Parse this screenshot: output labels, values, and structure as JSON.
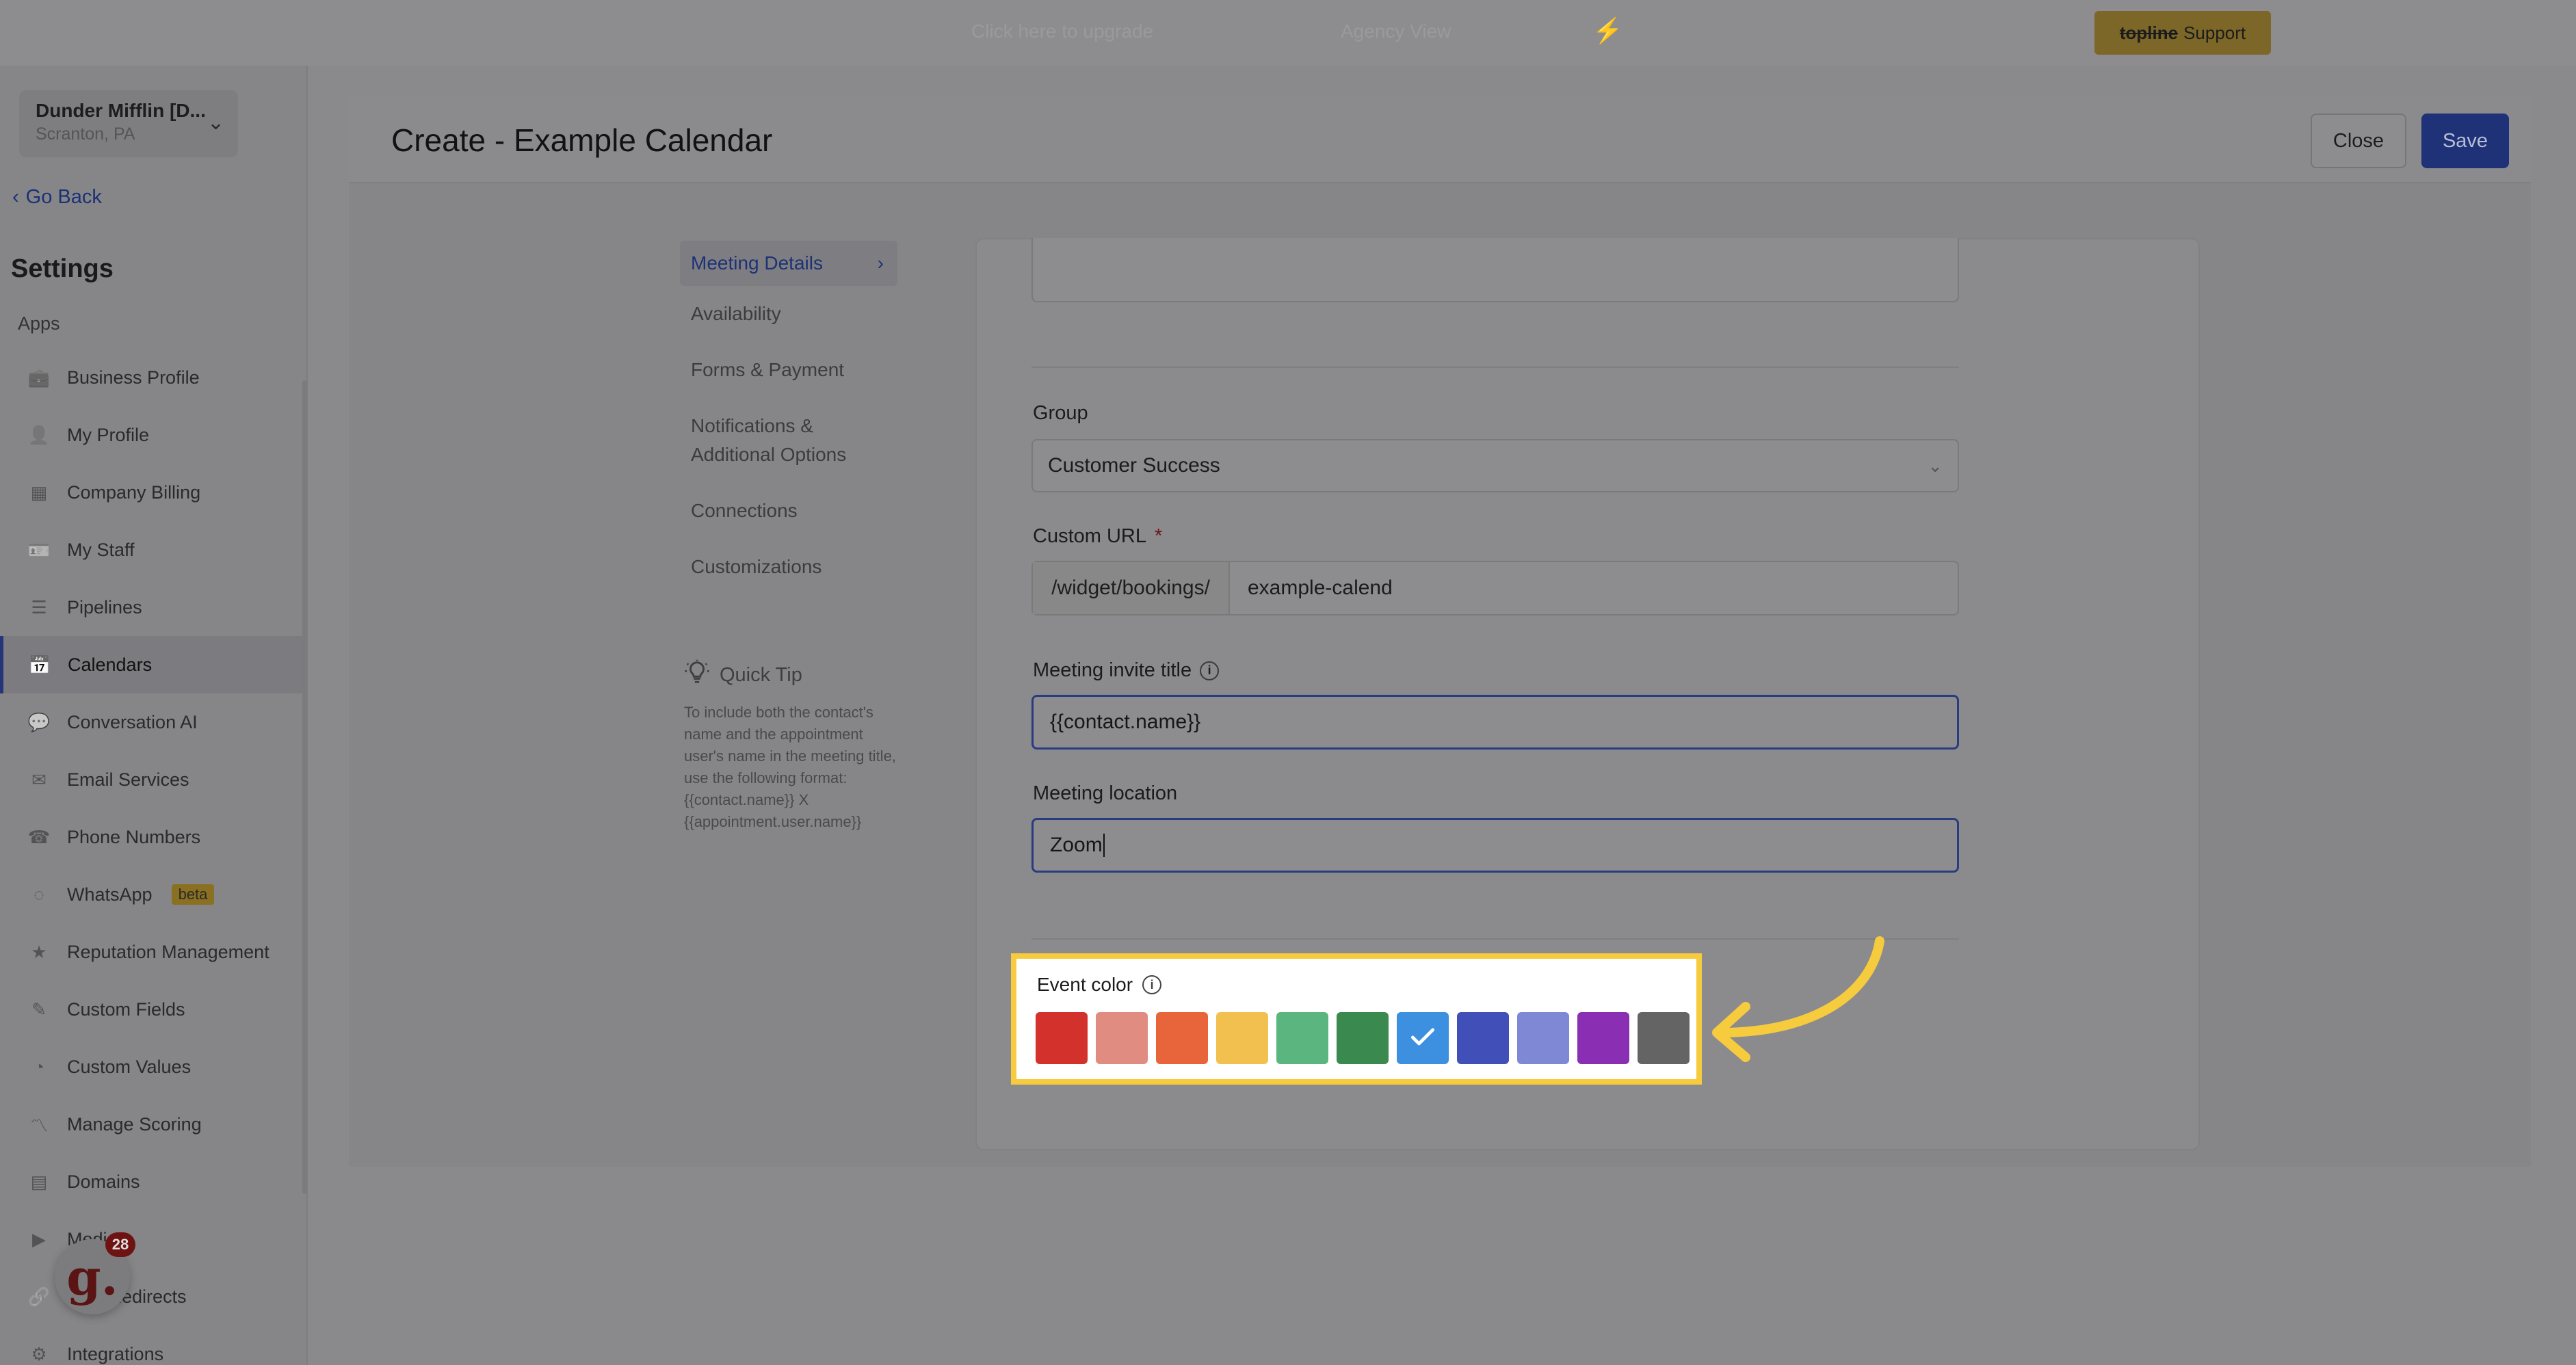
{
  "topbar": {
    "faded_left": "Click here to upgrade",
    "faded_mid": "Agency View",
    "support_brand": "topline",
    "support_label": "Support"
  },
  "sidebar": {
    "org_name": "Dunder Mifflin [D...",
    "org_location": "Scranton, PA",
    "go_back": "Go Back",
    "settings_title": "Settings",
    "apps_label": "Apps",
    "items": [
      {
        "label": "Business Profile",
        "icon": "briefcase-icon"
      },
      {
        "label": "My Profile",
        "icon": "person-icon"
      },
      {
        "label": "Company Billing",
        "icon": "grid-icon"
      },
      {
        "label": "My Staff",
        "icon": "id-card-icon"
      },
      {
        "label": "Pipelines",
        "icon": "funnel-icon"
      },
      {
        "label": "Calendars",
        "icon": "calendar-icon",
        "active": true
      },
      {
        "label": "Conversation AI",
        "icon": "chat-icon"
      },
      {
        "label": "Email Services",
        "icon": "mail-icon"
      },
      {
        "label": "Phone Numbers",
        "icon": "phone-icon"
      },
      {
        "label": "WhatsApp",
        "icon": "whatsapp-icon",
        "badge": "beta"
      },
      {
        "label": "Reputation Management",
        "icon": "star-icon"
      },
      {
        "label": "Custom Fields",
        "icon": "edit-field-icon"
      },
      {
        "label": "Custom Values",
        "icon": "pie-icon"
      },
      {
        "label": "Manage Scoring",
        "icon": "trend-icon"
      },
      {
        "label": "Domains",
        "icon": "server-icon"
      },
      {
        "label": "Media",
        "icon": "video-icon"
      },
      {
        "label": "URL Redirects",
        "icon": "link-icon"
      },
      {
        "label": "Integrations",
        "icon": "plug-icon"
      }
    ],
    "avatar_letter": "g.",
    "avatar_count": "28"
  },
  "header": {
    "title": "Create - Example Calendar",
    "close_label": "Close",
    "save_label": "Save"
  },
  "subnav": {
    "items": [
      "Meeting Details",
      "Availability",
      "Forms & Payment",
      "Notifications & Additional Options",
      "Connections",
      "Customizations"
    ],
    "active_index": 0,
    "quick_tip_title": "Quick Tip",
    "quick_tip_text": "To include both the contact's name and the appointment user's name in the meeting title, use the following format: {{contact.name}} X {{appointment.user.name}}"
  },
  "form": {
    "group_label": "Group",
    "group_value": "Customer Success",
    "custom_url_label": "Custom URL",
    "custom_url_required": "*",
    "custom_url_prefix": "/widget/bookings/",
    "custom_url_value": "example-calend",
    "invite_title_label": "Meeting invite title",
    "invite_title_value": "{{contact.name}}",
    "location_label": "Meeting location",
    "location_value": "Zoom",
    "event_color_label": "Event color",
    "event_colors": [
      "#d3322c",
      "#e08c80",
      "#e8643a",
      "#f2c04f",
      "#5ab67e",
      "#3a8a50",
      "#3d8fe0",
      "#414fb8",
      "#7e88d4",
      "#8a2fb3",
      "#646464"
    ],
    "selected_color_index": 6
  },
  "colors": {
    "highlight_border": "#f6cb3e",
    "arrow": "#f6cb3e",
    "save_button": "#1f3278"
  }
}
